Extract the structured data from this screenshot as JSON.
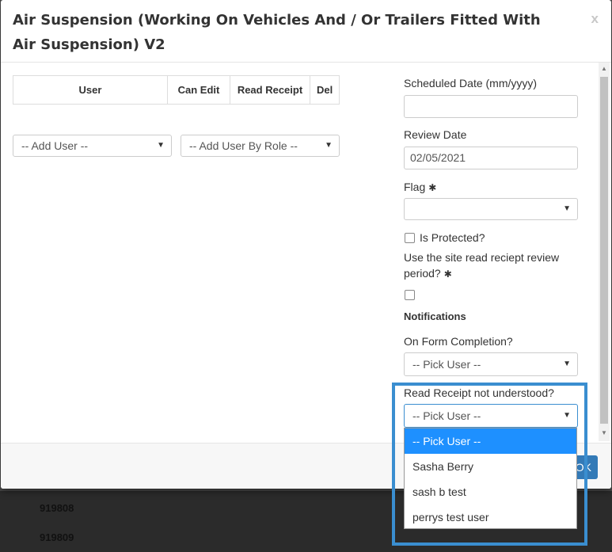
{
  "background": {
    "rows": [
      "919808",
      "919809"
    ]
  },
  "modal": {
    "title": "Air Suspension (Working On Vehicles And / Or Trailers Fitted With Air Suspension) V2",
    "close_label": "x"
  },
  "users_table": {
    "headers": [
      "User",
      "Can Edit",
      "Read Receipt",
      "Del"
    ]
  },
  "add_user": {
    "selected": "-- Add User --"
  },
  "add_user_by_role": {
    "selected": "-- Add User By Role --"
  },
  "form": {
    "scheduled_date": {
      "label": "Scheduled Date (mm/yyyy)",
      "value": ""
    },
    "review_date": {
      "label": "Review Date",
      "value": "02/05/2021"
    },
    "flag": {
      "label": "Flag",
      "required_mark": "✱",
      "selected": ""
    },
    "is_protected": {
      "label": "Is Protected?",
      "checked": false
    },
    "site_read_receipt": {
      "label_line1": "Use the site read reciept review",
      "label_line2": "period?",
      "required_mark": "✱",
      "checked": false
    },
    "notifications": {
      "title": "Notifications",
      "on_form_completion": {
        "label": "On Form Completion?",
        "selected": "-- Pick User --"
      },
      "read_receipt_not_understood": {
        "label": "Read Receipt not understood?",
        "selected": "-- Pick User --",
        "options": [
          "-- Pick User --",
          "Sasha Berry",
          "sash b test",
          "perrys test user"
        ]
      }
    }
  },
  "footer": {
    "button_label": "OK"
  },
  "colors": {
    "accent": "#337ab7",
    "highlight": "#3a8ed0",
    "selected_option": "#1e90ff"
  },
  "icons": {
    "caret": "caret-down-icon",
    "close": "close-icon",
    "required": "asterisk-icon"
  }
}
